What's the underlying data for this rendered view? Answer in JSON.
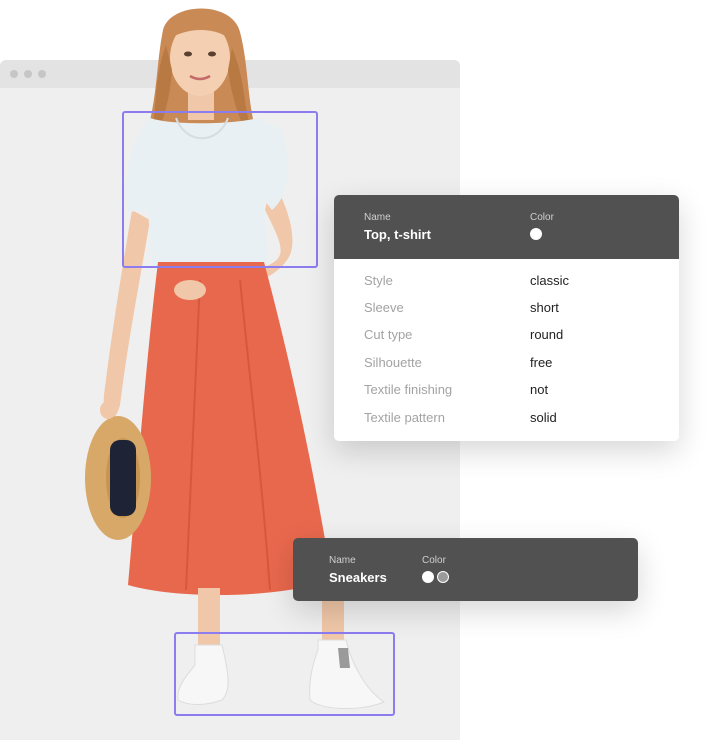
{
  "colors": {
    "accent": "#8b7cf0",
    "card_header": "#515151",
    "skirt": "#e8684d",
    "shirt": "#e9f0f3"
  },
  "top_card": {
    "name_label": "Name",
    "name_value": "Top, t-shirt",
    "color_label": "Color",
    "swatches": [
      "#ffffff"
    ],
    "attributes": [
      {
        "key": "Style",
        "value": "classic"
      },
      {
        "key": "Sleeve",
        "value": "short"
      },
      {
        "key": "Cut type",
        "value": "round"
      },
      {
        "key": "Silhouette",
        "value": "free"
      },
      {
        "key": "Textile finishing",
        "value": "not"
      },
      {
        "key": "Textile pattern",
        "value": "solid"
      }
    ]
  },
  "sneakers_card": {
    "name_label": "Name",
    "name_value": "Sneakers",
    "color_label": "Color",
    "swatches": [
      "#ffffff",
      "#9a9a9a"
    ]
  }
}
